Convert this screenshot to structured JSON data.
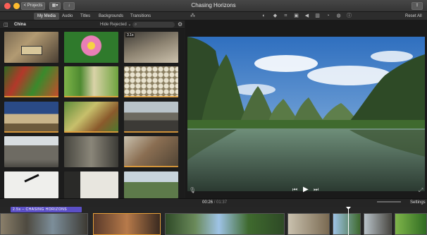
{
  "window": {
    "title": "Chasing Horizons"
  },
  "titlebar": {
    "projects_label": "< Projects"
  },
  "toolbar": {
    "tabs": [
      "My Media",
      "Audio",
      "Titles",
      "Backgrounds",
      "Transitions"
    ],
    "reset_all": "Reset All"
  },
  "library": {
    "album": "China",
    "filter": "Hide Rejected",
    "first_duration": "3.1s"
  },
  "viewer": {
    "timecode": "00:26",
    "duration": "01:37"
  },
  "timeline": {
    "settings_label": "Settings",
    "title_clip": "2.5s – CHASING HORIZONS"
  },
  "colors": {
    "accent": "#4a7fd4",
    "title_clip": "#5b4fc6",
    "selection": "#e8a13a"
  }
}
